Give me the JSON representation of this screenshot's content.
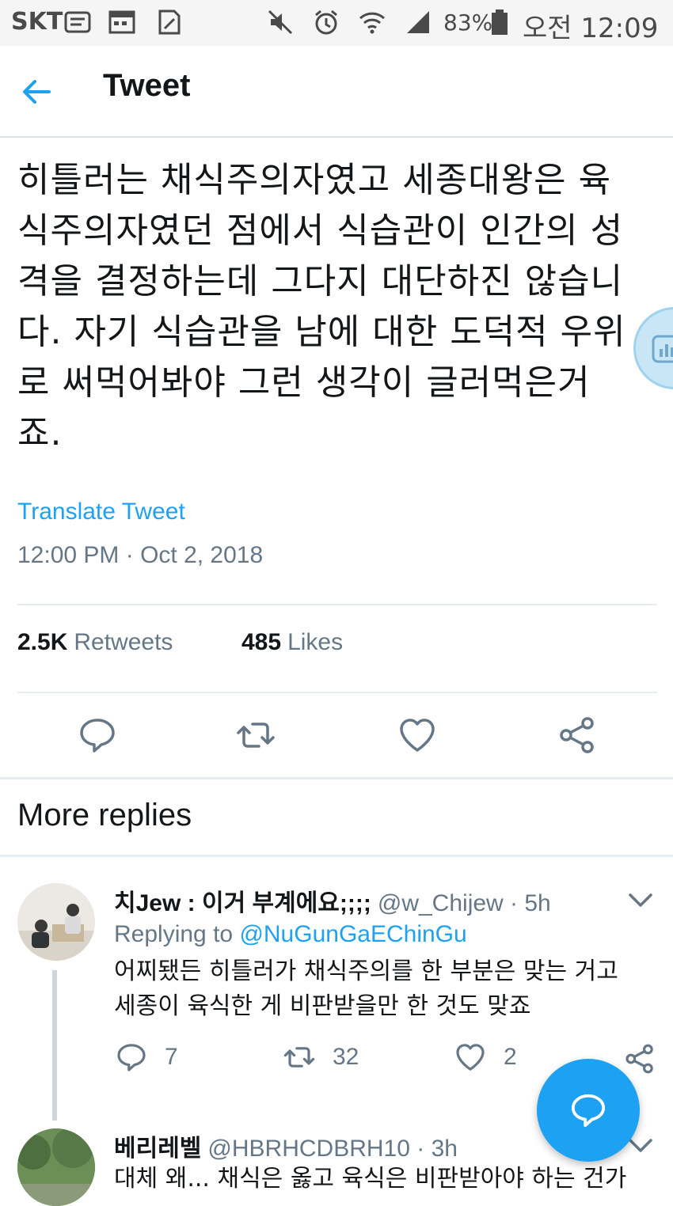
{
  "status_bar": {
    "carrier": "SKT",
    "battery": "83%",
    "time": "오전 12:09",
    "icons": [
      "notes-icon",
      "calendar-icon",
      "memo-icon",
      "mute-icon",
      "alarm-icon",
      "wifi-icon",
      "signal-icon",
      "battery-icon"
    ]
  },
  "header": {
    "title": "Tweet",
    "back_icon": "arrow-left-icon"
  },
  "tweet": {
    "lines": [
      "히틀러는 채식주의자였고 세종대왕은 육",
      "식주의자였던 점에서 식습관이 인간의 성",
      "격을 결정하는데 그다지 대단하진 않습니",
      "다. 자기 식습관을 남에 대한 도덕적 우위",
      "로 써먹어봐야 그런 생각이 글러먹은거",
      "죠."
    ],
    "translate_label": "Translate Tweet",
    "timestamp": "12:00 PM · Oct 2, 2018",
    "retweets_count": "2.5K",
    "retweets_label": "Retweets",
    "likes_count": "485",
    "likes_label": "Likes"
  },
  "more_replies_label": "More replies",
  "replies": [
    {
      "name": "치Jew : 이거 부계에요;;;;",
      "handle": "@w_Chijew · 5h",
      "replying_prefix": "Replying to",
      "replying_to": "@NuGunGaEChinGu",
      "text_lines": [
        "어찌됐든 히틀러가 채식주의를 한 부분은 맞는 거고",
        "세종이 육식한 게 비판받을만 한 것도 맞죠"
      ],
      "reply_count": "7",
      "retweet_count": "32",
      "like_count": "2"
    },
    {
      "name": "베리레벨",
      "handle": "@HBRHCDBRH10 · 3h",
      "text_lines": [
        "대체 왜... 채식은 옳고 육식은 비판받아야 하는 건가"
      ]
    }
  ],
  "colors": {
    "accent": "#1da1f2",
    "secondary_text": "#657786",
    "primary_text": "#14171a",
    "divider": "#e6ecf0"
  }
}
